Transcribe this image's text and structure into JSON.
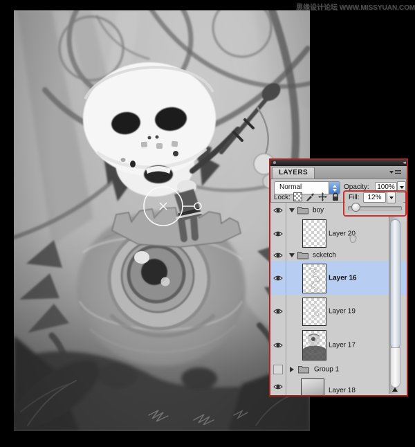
{
  "watermark": {
    "text": "思缘设计论坛 WWW.MISSYUAN.COM"
  },
  "canvas": {
    "description": "grayscale sketch painting: boy with skull helmet standing on a one-eyed furry creature",
    "annotation_symbol": "×"
  },
  "colors": {
    "highlight_red": "#c9302c",
    "panel_border_red": "#a8251f",
    "selection_blue": "#b7cdf2"
  },
  "panel": {
    "title_tab": "LAYERS",
    "blend_mode": {
      "value": "Normal"
    },
    "opacity": {
      "label": "Opacity:",
      "value": "100%"
    },
    "lock": {
      "label": "Lock:"
    },
    "fill": {
      "label": "Fill:",
      "value": "12%",
      "slider_percent": 12
    },
    "layers": [
      {
        "kind": "group",
        "name": "boy",
        "visible": true,
        "expanded": true
      },
      {
        "kind": "layer",
        "name": "Layer 20",
        "visible": true,
        "thumb": "transparent-checker"
      },
      {
        "kind": "group",
        "name": "scketch",
        "visible": true,
        "expanded": true
      },
      {
        "kind": "layer",
        "name": "Layer 16",
        "visible": true,
        "selected": true,
        "thumb": "transparent-sketch"
      },
      {
        "kind": "layer",
        "name": "Layer 19",
        "visible": true,
        "thumb": "transparent-sketch-faint"
      },
      {
        "kind": "layer",
        "name": "Layer 17",
        "visible": true,
        "thumb": "sketch-art"
      },
      {
        "kind": "group",
        "name": "Group 1",
        "visible": false,
        "expanded": false
      },
      {
        "kind": "layer",
        "name": "Layer 18",
        "visible": true,
        "thumb": "solid-gradient"
      }
    ]
  }
}
